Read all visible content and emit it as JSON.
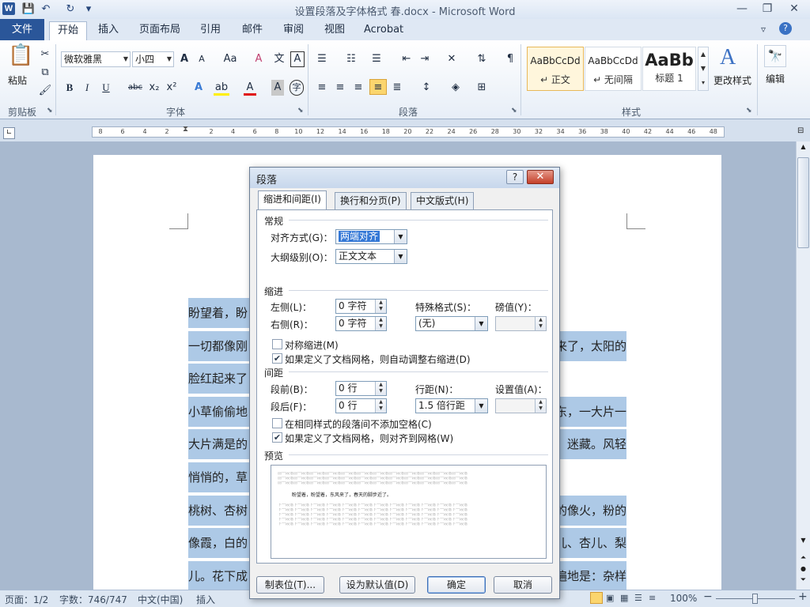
{
  "window": {
    "title": "设置段落及字体格式 春.docx  -  Microsoft Word",
    "app_icon_letter": "W",
    "qat": {
      "save": "💾",
      "undo": "↶",
      "redo": "↻",
      "customize": "▾"
    },
    "controls": {
      "minimize": "—",
      "restore": "❐",
      "close": "✕"
    }
  },
  "ribbon": {
    "file_tab": "文件",
    "tabs": [
      "开始",
      "插入",
      "页面布局",
      "引用",
      "邮件",
      "审阅",
      "视图",
      "Acrobat"
    ],
    "active_tab": "开始",
    "clipboard": {
      "paste_label": "粘贴",
      "group_label": "剪贴板"
    },
    "font": {
      "font_name": "微软雅黑",
      "font_size": "小四",
      "group_label": "字体",
      "bold": "B",
      "italic": "I",
      "underline": "U",
      "strike": "abc",
      "sub": "x₂",
      "sup": "x²",
      "grow": "A",
      "shrink": "A",
      "change_case": "Aa",
      "clear": "A",
      "color_a": "A",
      "char_border": "A",
      "enclose": "字"
    },
    "paragraph": {
      "group_label": "段落"
    },
    "styles": {
      "group_label": "样式",
      "items": [
        {
          "sample": "AaBbCcDd",
          "name": "↵ 正文"
        },
        {
          "sample": "AaBbCcDd",
          "name": "↵ 无间隔"
        },
        {
          "sample": "AaBb",
          "name": "标题 1"
        }
      ],
      "change_styles": "更改样式"
    },
    "editing": {
      "label": "编辑"
    }
  },
  "ruler": {
    "left_numbers": [
      "8",
      "6",
      "4",
      "2"
    ],
    "right_numbers": [
      "2",
      "4",
      "6",
      "8",
      "10",
      "12",
      "14",
      "16",
      "18",
      "20",
      "22",
      "24",
      "26",
      "28",
      "30",
      "32",
      "34",
      "36",
      "38",
      "40",
      "42",
      "44",
      "46",
      "48"
    ]
  },
  "document": {
    "lines": [
      "盼望着，盼",
      "一切都像刚",
      "脸红起来了",
      "小草偷偷地",
      "大片满是的",
      "悄悄的，草",
      "桃树、杏树",
      "像霞，白的",
      "儿。花下成"
    ],
    "right_fragments": [
      "来了，太阳的",
      "东，一大片一",
      "迷藏。风轻",
      "的像火，粉的",
      "儿、杏儿、梨",
      "遍地是：杂样"
    ]
  },
  "dialog": {
    "title": "段落",
    "help": "?",
    "close": "✕",
    "tabs": [
      "缩进和间距(I)",
      "换行和分页(P)",
      "中文版式(H)"
    ],
    "general": {
      "section": "常规",
      "alignment_label": "对齐方式(G)：",
      "alignment_value": "两端对齐",
      "outline_label": "大纲级别(O)：",
      "outline_value": "正文文本"
    },
    "indent": {
      "section": "缩进",
      "left_label": "左侧(L)：",
      "left_value": "0 字符",
      "right_label": "右侧(R)：",
      "right_value": "0 字符",
      "special_label": "特殊格式(S)：",
      "special_value": "(无)",
      "by_label": "磅值(Y)：",
      "by_value": "",
      "mirror_label": "对称缩进(M)",
      "mirror_checked": false,
      "auto_adjust_label": "如果定义了文档网格，则自动调整右缩进(D)",
      "auto_adjust_checked": true
    },
    "spacing": {
      "section": "间距",
      "before_label": "段前(B)：",
      "before_value": "0 行",
      "after_label": "段后(F)：",
      "after_value": "0 行",
      "line_label": "行距(N)：",
      "line_value": "1.5 倍行距",
      "at_label": "设置值(A)：",
      "at_value": "",
      "no_space_label": "在相同样式的段落间不添加空格(C)",
      "no_space_checked": false,
      "snap_label": "如果定义了文档网格，则对齐到网格(W)",
      "snap_checked": true
    },
    "preview": {
      "section": "预览",
      "sample_gray": "前一段落前一段落前一段落前一段落前一段落前一段落前一段落前一段落前一段落前一段落前一段落前一段落",
      "sample_text": "盼望着，盼望着，东风来了，春天的脚步近了。",
      "sample_after": "下一段落下一段落下一段落下一段落下一段落下一段落下一段落下一段落下一段落下一段落下一段落下一段落"
    },
    "buttons": {
      "tabs": "制表位(T)...",
      "set_default": "设为默认值(D)",
      "ok": "确定",
      "cancel": "取消"
    }
  },
  "status": {
    "page": "页面：1/2",
    "words": "字数：746/747",
    "language": "中文(中国)",
    "insert": "插入",
    "zoom": "100%",
    "zoom_out": "−",
    "zoom_in": "+"
  }
}
